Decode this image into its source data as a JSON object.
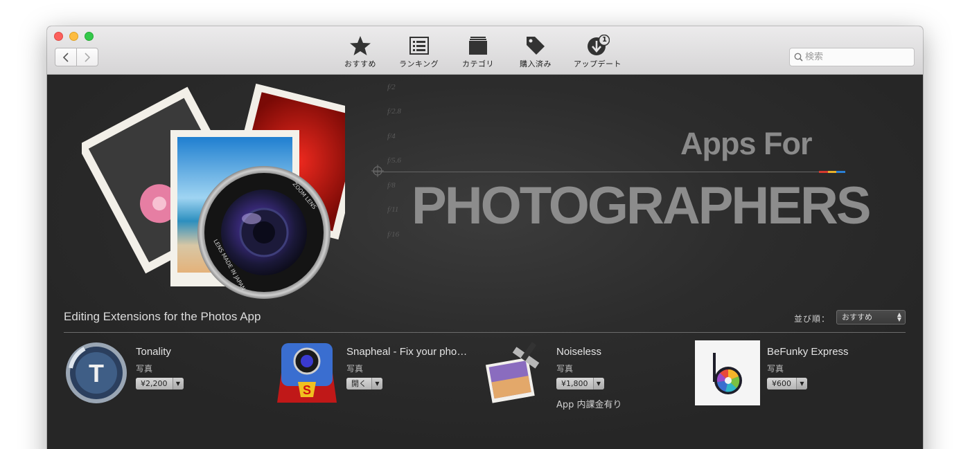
{
  "toolbar": {
    "back_icon": "chevron-left-icon",
    "forward_icon": "chevron-right-icon",
    "items": [
      {
        "label": "おすすめ",
        "icon": "star-icon"
      },
      {
        "label": "ランキング",
        "icon": "list-icon"
      },
      {
        "label": "カテゴリ",
        "icon": "box-icon"
      },
      {
        "label": "購入済み",
        "icon": "tag-icon"
      },
      {
        "label": "アップデート",
        "icon": "update-icon",
        "badge": "1"
      }
    ],
    "search_placeholder": "検索"
  },
  "banner": {
    "headline_top": "Apps For",
    "headline_main": "PHOTOGRAPHERS",
    "fstops": [
      "f/2",
      "f/2.8",
      "f/4",
      "f/5.6",
      "f/8",
      "f/11",
      "f/16"
    ],
    "lens_text_top": "ZOOM LENS",
    "lens_text_bottom": "LENS MADE IN JAPAN",
    "stripe_colors": [
      "#d43a2f",
      "#e8b02a",
      "#2a7fd4"
    ]
  },
  "section": {
    "title": "Editing Extensions for the Photos App",
    "sort_label": "並び順：",
    "sort_value": "おすすめ"
  },
  "apps": [
    {
      "name": "Tonality",
      "category": "写真",
      "price": "¥2,200",
      "iap": ""
    },
    {
      "name": "Snapheal - Fix your pho…",
      "category": "写真",
      "price": "開く",
      "iap": ""
    },
    {
      "name": "Noiseless",
      "category": "写真",
      "price": "¥1,800",
      "iap": "App 内課金有り"
    },
    {
      "name": "BeFunky Express",
      "category": "写真",
      "price": "¥600",
      "iap": ""
    }
  ]
}
